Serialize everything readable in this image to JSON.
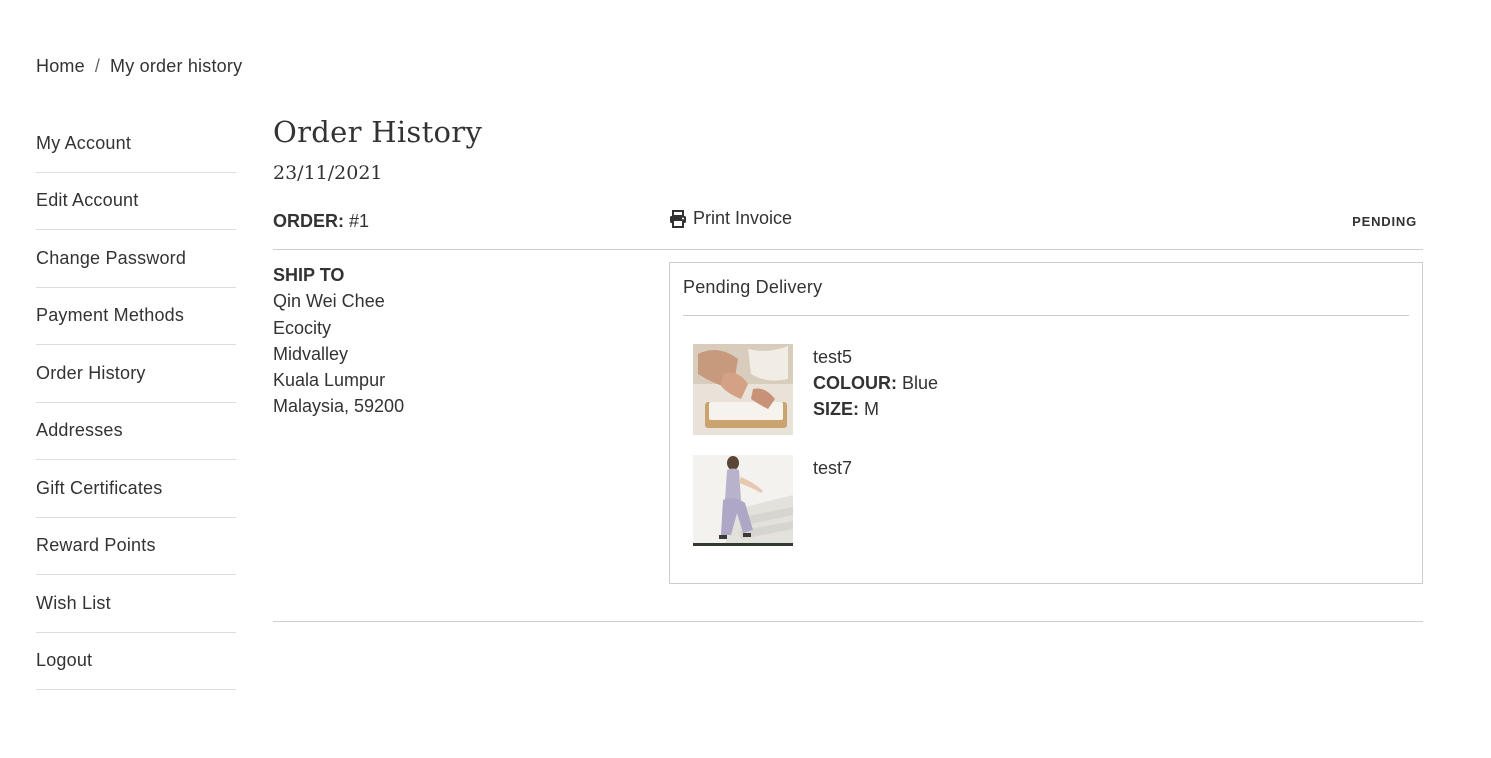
{
  "breadcrumb": {
    "home": "Home",
    "separator": "/",
    "current": "My order history"
  },
  "sidebar": {
    "items": [
      {
        "label": "My Account"
      },
      {
        "label": "Edit Account"
      },
      {
        "label": "Change Password"
      },
      {
        "label": "Payment Methods"
      },
      {
        "label": "Order History"
      },
      {
        "label": "Addresses"
      },
      {
        "label": "Gift Certificates"
      },
      {
        "label": "Reward Points"
      },
      {
        "label": "Wish List"
      },
      {
        "label": "Logout"
      }
    ]
  },
  "main": {
    "title": "Order History",
    "date": "23/11/2021",
    "order": {
      "label": "ORDER:",
      "number": "#1",
      "print_label": "Print Invoice",
      "status": "PENDING"
    },
    "ship_to": {
      "title": "SHIP TO",
      "lines": [
        "Qin Wei Chee",
        "Ecocity",
        "Midvalley",
        "Kuala Lumpur",
        "Malaysia, 59200"
      ]
    },
    "delivery": {
      "header": "Pending Delivery",
      "products": [
        {
          "name": "test5",
          "colour_label": "COLOUR:",
          "colour": "Blue",
          "size_label": "SIZE:",
          "size": "M"
        },
        {
          "name": "test7"
        }
      ]
    }
  },
  "colors": {
    "text": "#333333",
    "divider": "#dddddd",
    "border": "#cccccc"
  },
  "icons": {
    "print": "printer-icon"
  }
}
